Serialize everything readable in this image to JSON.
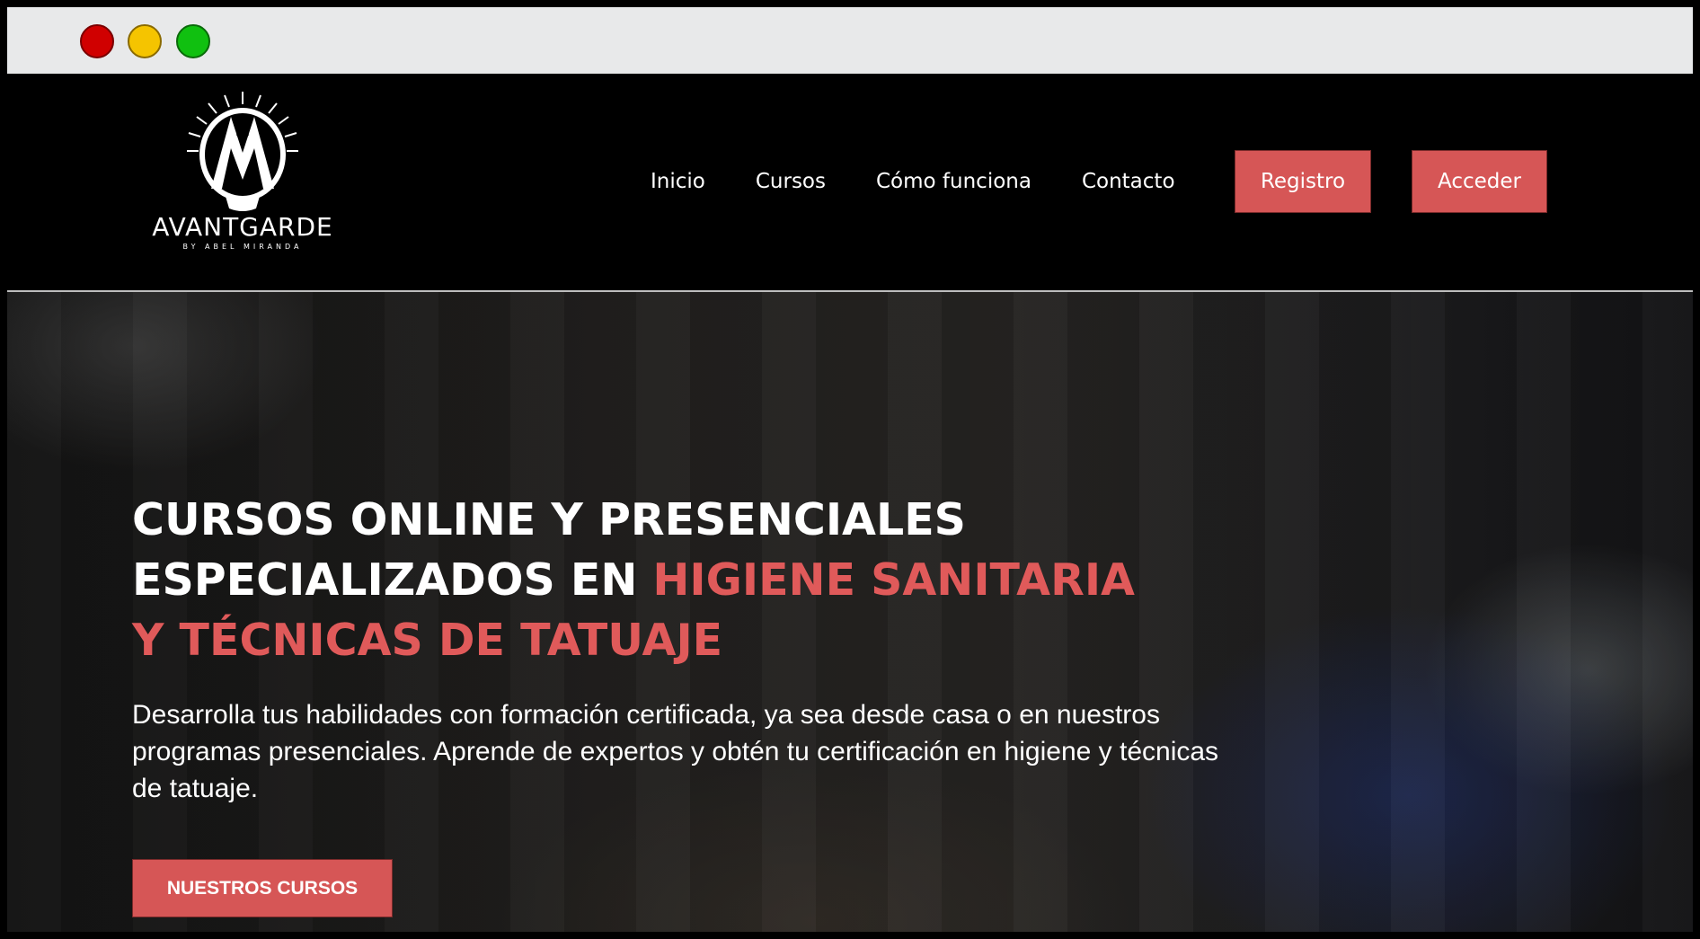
{
  "window": {
    "controls": [
      "close-dot",
      "minimize-dot",
      "maximize-dot"
    ],
    "colors": {
      "close": "#d00000",
      "minimize": "#f5c400",
      "maximize": "#10c010"
    }
  },
  "header": {
    "logo": {
      "wordmark": "AVANTGARDE",
      "subtitle": "BY ABEL MIRANDA"
    },
    "nav": [
      {
        "label": "Inicio"
      },
      {
        "label": "Cursos"
      },
      {
        "label": "Cómo funciona"
      },
      {
        "label": "Contacto"
      }
    ],
    "registro_label": "Registro",
    "acceder_label": "Acceder"
  },
  "hero": {
    "title_white_1": "CURSOS ONLINE Y PRESENCIALES",
    "title_white_2": "ESPECIALIZADOS EN ",
    "title_accent_1": "HIGIENE SANITARIA",
    "title_accent_2": "Y TÉCNICAS DE TATUAJE",
    "description": "Desarrolla tus habilidades con formación certificada, ya sea desde casa o en nuestros programas presenciales. Aprende de expertos y obtén tu certificación en higiene y técnicas de tatuaje.",
    "cta_label": "NUESTROS CURSOS"
  },
  "colors": {
    "accent": "#d65656",
    "accent_text": "#e05a5a",
    "background": "#000000"
  }
}
